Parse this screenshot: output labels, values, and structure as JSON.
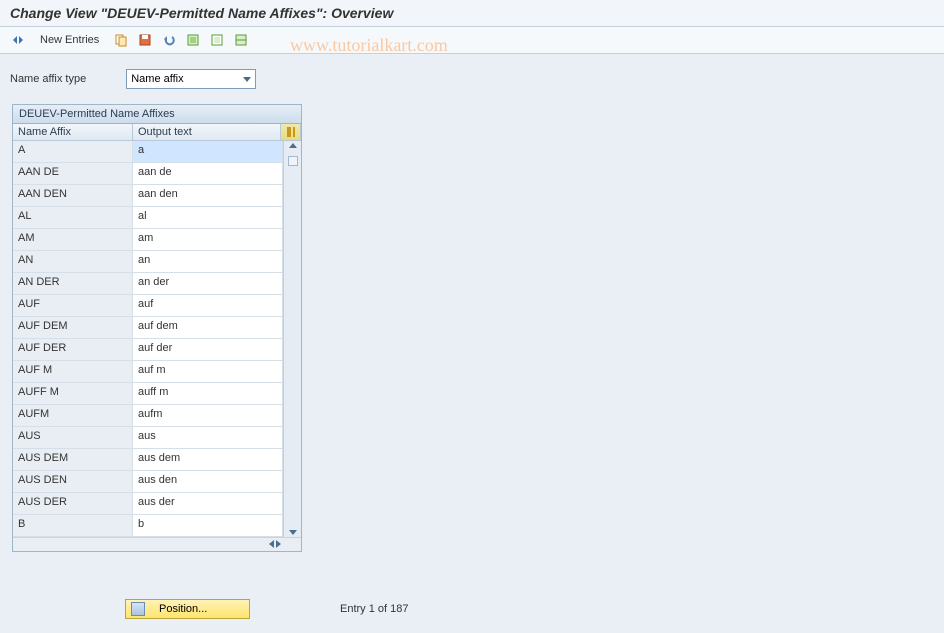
{
  "title": "Change View \"DEUEV-Permitted Name Affixes\": Overview",
  "watermark": "www.tutorialkart.com",
  "toolbar": {
    "new_entries": "New Entries"
  },
  "field": {
    "label": "Name affix type",
    "value": "Name affix"
  },
  "table": {
    "title": "DEUEV-Permitted Name Affixes",
    "columns": {
      "affix": "Name Affix",
      "text": "Output text"
    },
    "rows": [
      {
        "affix": "A",
        "text": "a"
      },
      {
        "affix": "AAN DE",
        "text": "aan de"
      },
      {
        "affix": "AAN DEN",
        "text": "aan den"
      },
      {
        "affix": "AL",
        "text": "al"
      },
      {
        "affix": "AM",
        "text": "am"
      },
      {
        "affix": "AN",
        "text": "an"
      },
      {
        "affix": "AN DER",
        "text": "an der"
      },
      {
        "affix": "AUF",
        "text": "auf"
      },
      {
        "affix": "AUF DEM",
        "text": "auf dem"
      },
      {
        "affix": "AUF DER",
        "text": "auf der"
      },
      {
        "affix": "AUF M",
        "text": "auf m"
      },
      {
        "affix": "AUFF M",
        "text": "auff m"
      },
      {
        "affix": "AUFM",
        "text": "aufm"
      },
      {
        "affix": "AUS",
        "text": "aus"
      },
      {
        "affix": "AUS DEM",
        "text": "aus dem"
      },
      {
        "affix": "AUS DEN",
        "text": "aus den"
      },
      {
        "affix": "AUS DER",
        "text": "aus der"
      },
      {
        "affix": "B",
        "text": "b"
      }
    ]
  },
  "footer": {
    "position_label": "Position...",
    "entry_text": "Entry 1 of 187"
  }
}
